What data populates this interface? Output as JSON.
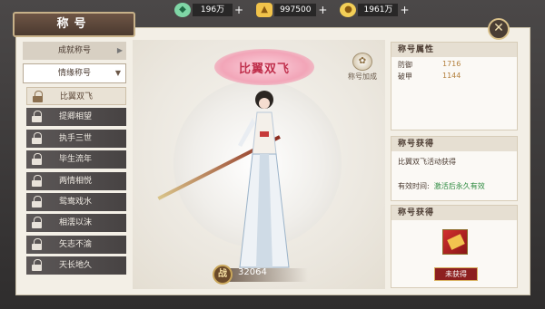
{
  "resources": [
    {
      "icon": "jade-icon",
      "value": "196万"
    },
    {
      "icon": "gold-ingot-icon",
      "value": "997500"
    },
    {
      "icon": "coins-icon",
      "value": "1961万"
    }
  ],
  "window": {
    "title": "称号"
  },
  "categories": {
    "achievement": "成就称号",
    "romance": "情缘称号"
  },
  "title_list": [
    {
      "label": "比翼双飞",
      "selected": true
    },
    {
      "label": "提卿相望",
      "selected": false
    },
    {
      "label": "执手三世",
      "selected": false
    },
    {
      "label": "毕生流年",
      "selected": false
    },
    {
      "label": "两情相悦",
      "selected": false
    },
    {
      "label": "鸳鸯戏水",
      "selected": false
    },
    {
      "label": "相濡以沫",
      "selected": false
    },
    {
      "label": "矢志不渝",
      "selected": false
    },
    {
      "label": "天长地久",
      "selected": false
    }
  ],
  "center": {
    "badge_text": "比翼双飞",
    "bonus_label": "称号加成",
    "power_seal": "战",
    "power_value": "32064"
  },
  "attributes": {
    "header": "称号属性",
    "rows": [
      {
        "name": "防御",
        "value": "1716"
      },
      {
        "name": "破甲",
        "value": "1144"
      }
    ]
  },
  "acquire": {
    "header": "称号获得",
    "desc": "比翼双飞活动获得",
    "valid_label": "有效时间:",
    "valid_value": "激活后永久有效"
  },
  "item": {
    "header": "称号获得",
    "button": "未获得"
  },
  "colors": {
    "accent_red": "#c0304d",
    "value_gold": "#b4813e",
    "valid_green": "#2c8a3f"
  }
}
